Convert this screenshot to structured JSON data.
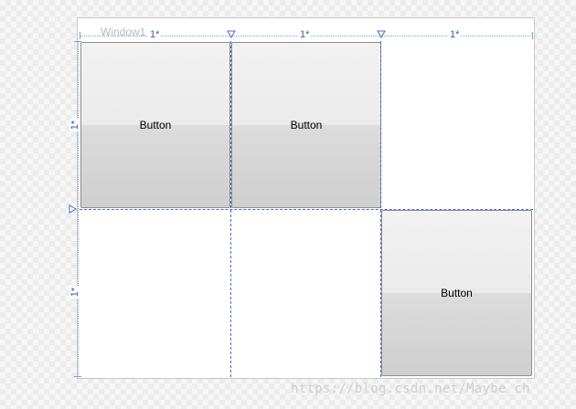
{
  "window": {
    "title": "Window1"
  },
  "grid": {
    "column_sizes": [
      "1*",
      "1*",
      "1*"
    ],
    "row_sizes": [
      "1*",
      "1*"
    ]
  },
  "buttons": [
    {
      "label": "Button",
      "row": 0,
      "column": 0
    },
    {
      "label": "Button",
      "row": 0,
      "column": 1
    },
    {
      "label": "Button",
      "row": 1,
      "column": 2
    }
  ],
  "watermark": "https://blog.csdn.net/Maybe_ch",
  "colors": {
    "gridline": "#3d6fd6",
    "size_label": "#2f5bbd"
  }
}
